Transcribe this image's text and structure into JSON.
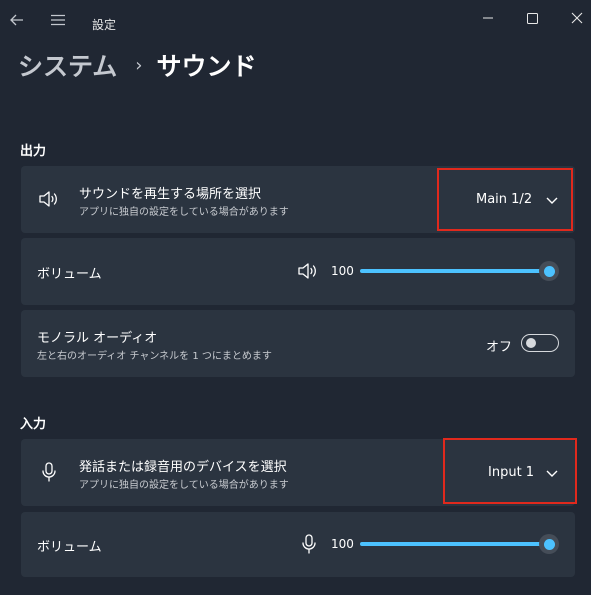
{
  "window": {
    "title": "設定"
  },
  "breadcrumb": {
    "parent": "システム",
    "separator": "›",
    "current": "サウンド"
  },
  "output": {
    "header": "出力",
    "device": {
      "title": "サウンドを再生する場所を選択",
      "subtitle": "アプリに独自の設定をしている場合があります",
      "selected": "Main 1/2",
      "icon": "speaker-icon"
    },
    "volume": {
      "label": "ボリューム",
      "value_text": "100",
      "value": 100,
      "icon": "speaker-icon"
    },
    "mono": {
      "title": "モノラル オーディオ",
      "subtitle": "左と右のオーディオ チャンネルを 1 つにまとめます",
      "state": "オフ",
      "on": false
    }
  },
  "input": {
    "header": "入力",
    "device": {
      "title": "発話または録音用のデバイスを選択",
      "subtitle": "アプリに独自の設定をしている場合があります",
      "selected": "Input 1",
      "icon": "microphone-icon"
    },
    "volume": {
      "label": "ボリューム",
      "value_text": "100",
      "value": 100,
      "icon": "microphone-icon"
    }
  },
  "colors": {
    "background": "#202733",
    "card": "#2b3440",
    "accent": "#4cc2ff",
    "highlight": "#e0291d"
  }
}
